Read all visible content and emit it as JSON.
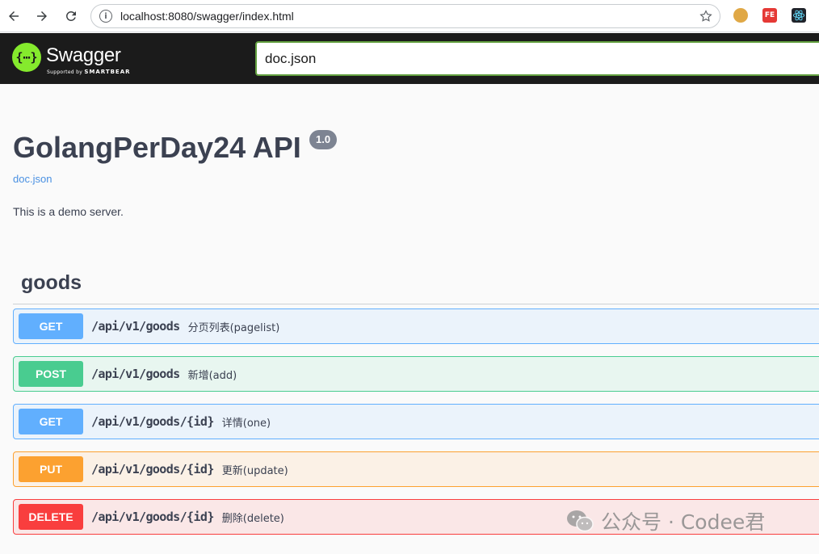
{
  "browser": {
    "url": "localhost:8080/swagger/index.html",
    "extensions": [
      {
        "name": "cookie-extension-icon",
        "label": "",
        "color": "#d9a441"
      },
      {
        "name": "fe-extension-icon",
        "label": "FE",
        "color": "#e53935"
      },
      {
        "name": "react-devtools-icon",
        "label": "",
        "color": "#20232a"
      }
    ]
  },
  "topbar": {
    "logo_name": "Swagger",
    "logo_sub_prefix": "Supported by",
    "logo_sub_brand": "SMARTBEAR",
    "spec_url": "doc.json",
    "accent": "#85ea2d"
  },
  "info": {
    "title": "GolangPerDay24 API",
    "version": "1.0",
    "spec_link": "doc.json",
    "description": "This is a demo server."
  },
  "tag": {
    "name": "goods"
  },
  "operations": [
    {
      "method": "GET",
      "path": "/api/v1/goods",
      "summary": "分页列表(pagelist)",
      "color": "#61affe"
    },
    {
      "method": "POST",
      "path": "/api/v1/goods",
      "summary": "新增(add)",
      "color": "#49cc90"
    },
    {
      "method": "GET",
      "path": "/api/v1/goods/{id}",
      "summary": "详情(one)",
      "color": "#61affe"
    },
    {
      "method": "PUT",
      "path": "/api/v1/goods/{id}",
      "summary": "更新(update)",
      "color": "#fca130"
    },
    {
      "method": "DELETE",
      "path": "/api/v1/goods/{id}",
      "summary": "删除(delete)",
      "color": "#f93e3e"
    }
  ],
  "watermark": {
    "text": "公众号 · Codee君"
  }
}
